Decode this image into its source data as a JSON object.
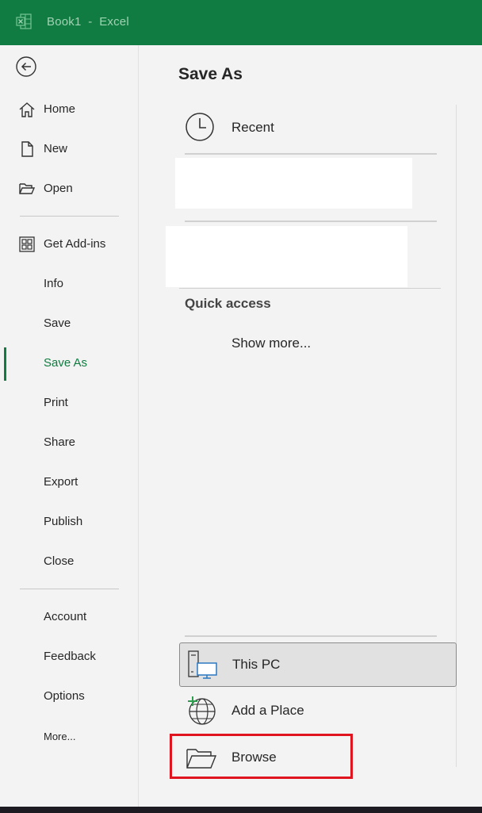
{
  "titlebar": {
    "app_icon": "excel-logo-icon",
    "title": "Book1  -  Excel"
  },
  "sidebar": {
    "back_icon": "back-arrow-icon",
    "items": [
      {
        "label": "Home",
        "icon": "home-icon"
      },
      {
        "label": "New",
        "icon": "new-document-icon"
      },
      {
        "label": "Open",
        "icon": "folder-open-icon"
      },
      {
        "label": "Get Add-ins",
        "icon": "add-ins-grid-icon"
      },
      {
        "label": "Info"
      },
      {
        "label": "Save"
      },
      {
        "label": "Save As",
        "active": true
      },
      {
        "label": "Print"
      },
      {
        "label": "Share"
      },
      {
        "label": "Export"
      },
      {
        "label": "Publish"
      },
      {
        "label": "Close"
      },
      {
        "label": "Account"
      },
      {
        "label": "Feedback"
      },
      {
        "label": "Options"
      },
      {
        "label": "More..."
      }
    ]
  },
  "main": {
    "title": "Save As",
    "recent": {
      "label": "Recent",
      "icon": "clock-icon"
    },
    "quick_access": {
      "heading": "Quick access",
      "show_more": "Show more..."
    },
    "locations": [
      {
        "label": "This PC",
        "icon": "this-pc-icon",
        "selected": true
      },
      {
        "label": "Add a Place",
        "icon": "globe-add-icon"
      },
      {
        "label": "Browse",
        "icon": "folder-browse-icon",
        "highlighted": true
      }
    ]
  },
  "colors": {
    "accent": "#107c41",
    "highlight_box": "#e0141e"
  }
}
